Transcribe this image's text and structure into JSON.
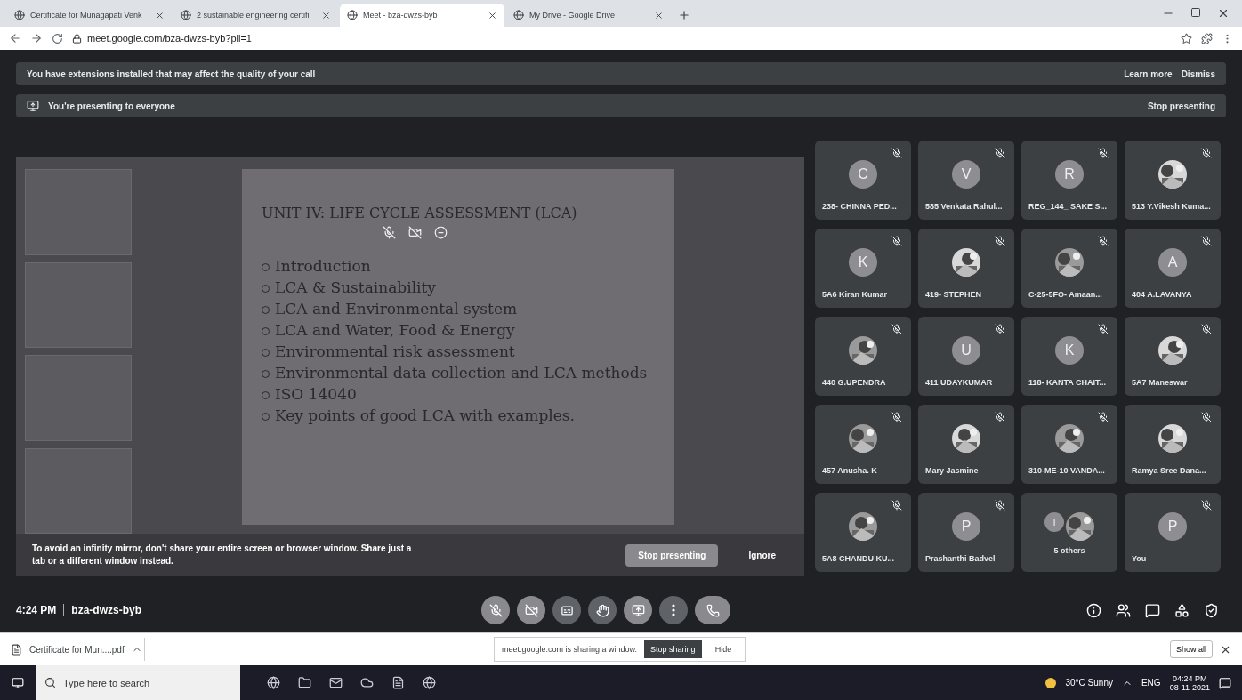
{
  "browser": {
    "tabs": [
      {
        "title": "Certificate for Munagapati Venk",
        "selected": false
      },
      {
        "title": "2 sustainable engineering certifi",
        "selected": false
      },
      {
        "title": "Meet - bza-dwzs-byb",
        "selected": true
      },
      {
        "title": "My Drive - Google Drive",
        "selected": false
      }
    ],
    "url": "meet.google.com/bza-dwzs-byb?pli=1"
  },
  "banners": [
    {
      "text": "You have extensions installed that may affect the quality of your call",
      "actions": [
        "Learn more",
        "Dismiss"
      ]
    },
    {
      "text": "You're presenting to everyone",
      "actions": [
        "Stop presenting"
      ]
    }
  ],
  "presentation": {
    "slide_title": "UNIT IV: LIFE CYCLE ASSESSMENT (LCA)",
    "bullets": [
      "Introduction",
      "LCA & Sustainability",
      "LCA and Environmental system",
      "LCA and Water, Food & Energy",
      "Environmental risk assessment",
      "Environmental data collection and LCA methods",
      "ISO 14040",
      "Key points of good LCA with examples."
    ],
    "warning": "To avoid an infinity mirror, don't share your entire screen or browser window. Share just a tab or a different window instead.",
    "buttons": [
      "Stop presenting",
      "Ignore"
    ]
  },
  "participants": [
    {
      "name": "238- CHINNA PED...",
      "kind": "letter",
      "initial": "C",
      "muted": true
    },
    {
      "name": "585 Venkata Rahul...",
      "kind": "letter",
      "initial": "V",
      "muted": true
    },
    {
      "name": "REG_144_ SAKE S...",
      "kind": "letter",
      "initial": "R",
      "muted": true
    },
    {
      "name": "513 Y.Vikesh Kuma...",
      "kind": "picture",
      "muted": true
    },
    {
      "name": "5A6 Kiran Kumar",
      "kind": "letter",
      "initial": "K",
      "muted": true
    },
    {
      "name": "419- STEPHEN",
      "kind": "picture",
      "muted": true
    },
    {
      "name": "C-25-5FO- Amaan...",
      "kind": "picture",
      "muted": true
    },
    {
      "name": "404 A.LAVANYA",
      "kind": "letter",
      "initial": "A",
      "muted": true
    },
    {
      "name": "440 G.UPENDRA",
      "kind": "picture",
      "muted": true
    },
    {
      "name": "411 UDAYKUMAR",
      "kind": "letter",
      "initial": "U",
      "muted": true
    },
    {
      "name": "118- KANTA CHAIT...",
      "kind": "letter",
      "initial": "K",
      "muted": true
    },
    {
      "name": "5A7 Maneswar",
      "kind": "picture",
      "muted": true
    },
    {
      "name": "457 Anusha. K",
      "kind": "picture",
      "muted": true
    },
    {
      "name": "Mary Jasmine",
      "kind": "picture",
      "muted": true
    },
    {
      "name": "310-ME-10 VANDA...",
      "kind": "picture",
      "muted": true
    },
    {
      "name": "Ramya Sree Dana...",
      "kind": "picture",
      "muted": true
    },
    {
      "name": "5A8 CHANDU KU...",
      "kind": "picture",
      "muted": true
    },
    {
      "name": "Prashanthi Badvel",
      "kind": "letter",
      "initial": "P",
      "muted": true
    },
    {
      "name": "5 others",
      "kind": "others",
      "initial": "T",
      "muted": false
    },
    {
      "name": "You",
      "kind": "letter",
      "initial": "P",
      "muted": true
    }
  ],
  "call_bar": {
    "time": "4:24 PM",
    "meeting_code": "bza-dwzs-byb"
  },
  "downloads": {
    "file": "Certificate for Mun....pdf",
    "show_all": "Show all"
  },
  "sharing_bar": {
    "text": "meet.google.com is sharing a window.",
    "stop": "Stop sharing",
    "hide": "Hide"
  },
  "taskbar": {
    "search_placeholder": "Type here to search",
    "weather": "30°C Sunny",
    "language": "ENG",
    "time": "04:24 PM",
    "date": "08-11-2021"
  }
}
